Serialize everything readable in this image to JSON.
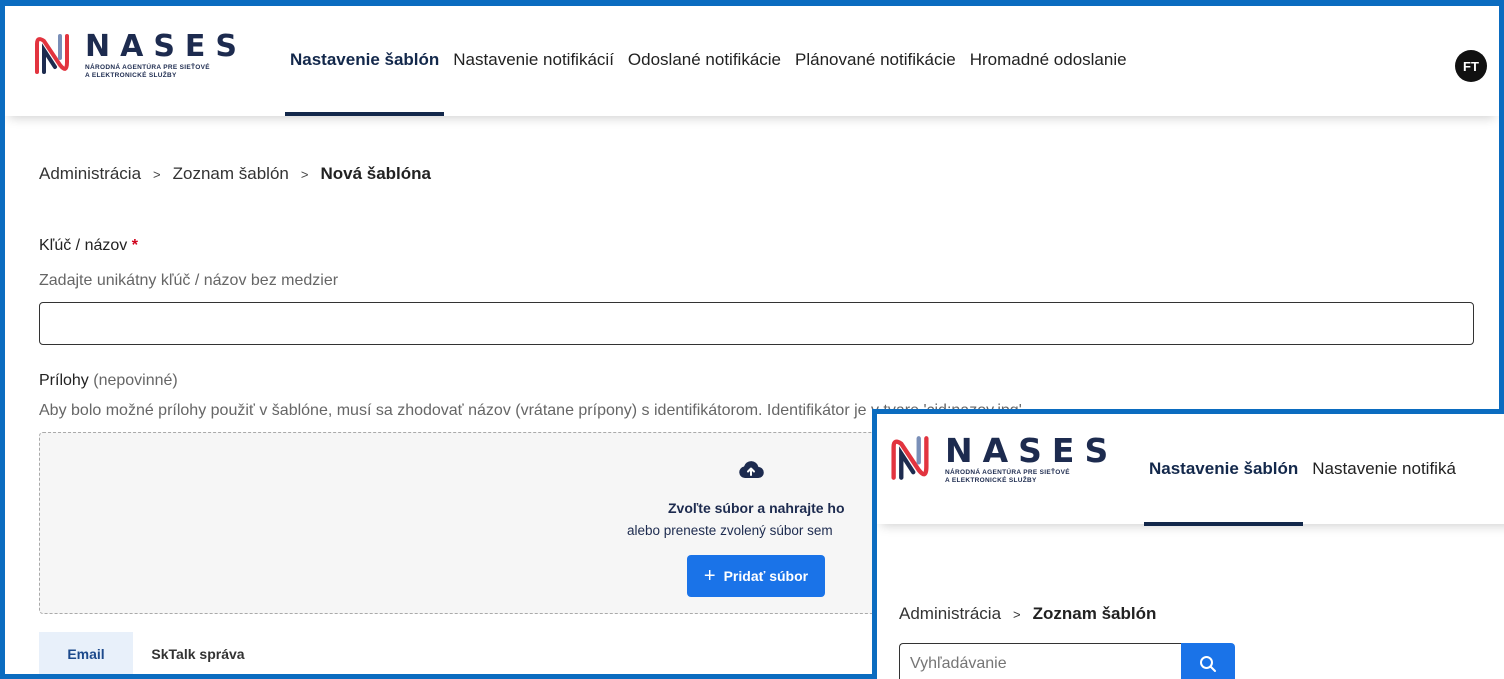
{
  "brand": {
    "name": "NASES",
    "subtitle_line1": "NÁRODNÁ AGENTÚRA PRE SIEŤOVÉ",
    "subtitle_line2": "A ELEKTRONICKÉ SLUŽBY",
    "colors": {
      "primary": "#13284b",
      "accent": "#1a73e8",
      "frame": "#0b6cc0",
      "logo_red": "#e2343f",
      "logo_blue": "#1d2b4f"
    }
  },
  "nav": {
    "items": [
      {
        "label": "Nastavenie šablón",
        "active": true
      },
      {
        "label": "Nastavenie notifikácií",
        "active": false
      },
      {
        "label": "Odoslané notifikácie",
        "active": false
      },
      {
        "label": "Plánované notifikácie",
        "active": false
      },
      {
        "label": "Hromadné odoslanie",
        "active": false
      }
    ],
    "avatar_initials": "FT"
  },
  "breadcrumb": {
    "items": [
      "Administrácia",
      "Zoznam šablón"
    ],
    "current": "Nová šablóna",
    "separator": ">"
  },
  "form": {
    "key_label": "Kľúč / názov",
    "required_mark": "*",
    "key_hint": "Zadajte unikátny kľúč / názov bez medzier",
    "key_value": "",
    "attachments_label": "Prílohy",
    "attachments_optional": "(nepovinné)",
    "attachments_hint": "Aby bolo možné prílohy použiť v šablóne, musí sa zhodovať názov (vrátane prípony) s identifikátorom. Identifikátor je v tvare 'cid:nazov.jpg'",
    "dropzone_title": "Zvoľte súbor a nahrajte ho",
    "dropzone_subtitle": "alebo preneste zvolený súbor sem",
    "add_file_label": "Pridať súbor"
  },
  "tabs": [
    {
      "label": "Email",
      "active": true
    },
    {
      "label": "SkTalk správa",
      "active": false
    }
  ],
  "overlay": {
    "nav": [
      {
        "label": "Nastavenie šablón",
        "active": true
      },
      {
        "label": "Nastavenie notifiká",
        "active": false
      }
    ],
    "breadcrumb": {
      "items": [
        "Administrácia"
      ],
      "current": "Zoznam šablón",
      "separator": ">"
    },
    "search": {
      "placeholder": "Vyhľadávanie",
      "value": ""
    }
  }
}
